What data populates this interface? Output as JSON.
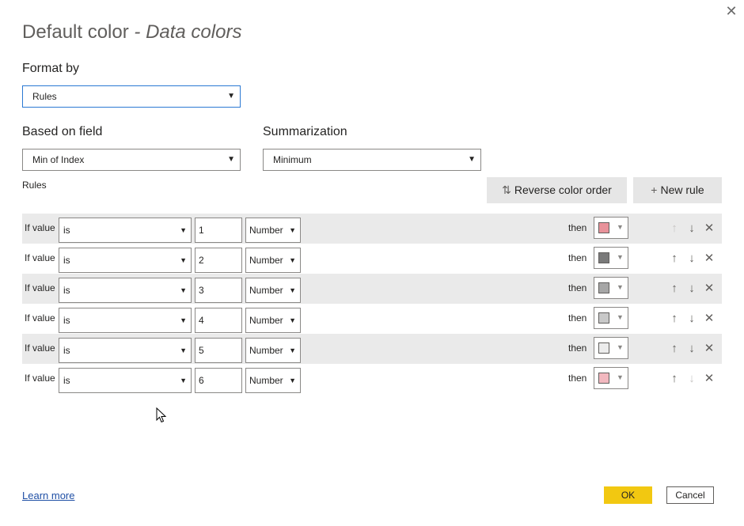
{
  "dialog": {
    "title_main": "Default color",
    "title_sub": "- Data colors"
  },
  "format_by": {
    "label": "Format by",
    "value": "Rules"
  },
  "based_on_field": {
    "label": "Based on field",
    "value": "Min of Index"
  },
  "summarization": {
    "label": "Summarization",
    "value": "Minimum"
  },
  "rules_section": {
    "label": "Rules",
    "reverse_label": "Reverse color order",
    "new_rule_label": "New rule"
  },
  "rules": [
    {
      "if_label": "If value",
      "operator": "is",
      "value": "1",
      "type": "Number",
      "then_label": "then",
      "color": "#e8929a",
      "up_enabled": false,
      "down_enabled": true
    },
    {
      "if_label": "If value",
      "operator": "is",
      "value": "2",
      "type": "Number",
      "then_label": "then",
      "color": "#7a7a7a",
      "up_enabled": true,
      "down_enabled": true
    },
    {
      "if_label": "If value",
      "operator": "is",
      "value": "3",
      "type": "Number",
      "then_label": "then",
      "color": "#a6a6a6",
      "up_enabled": true,
      "down_enabled": true
    },
    {
      "if_label": "If value",
      "operator": "is",
      "value": "4",
      "type": "Number",
      "then_label": "then",
      "color": "#c8c8c8",
      "up_enabled": true,
      "down_enabled": true
    },
    {
      "if_label": "If value",
      "operator": "is",
      "value": "5",
      "type": "Number",
      "then_label": "then",
      "color": "#ececec",
      "up_enabled": true,
      "down_enabled": true
    },
    {
      "if_label": "If value",
      "operator": "is",
      "value": "6",
      "type": "Number",
      "then_label": "then",
      "color": "#f2b8bf",
      "up_enabled": true,
      "down_enabled": false
    }
  ],
  "footer": {
    "learn_more": "Learn more",
    "ok_label": "OK",
    "cancel_label": "Cancel"
  }
}
